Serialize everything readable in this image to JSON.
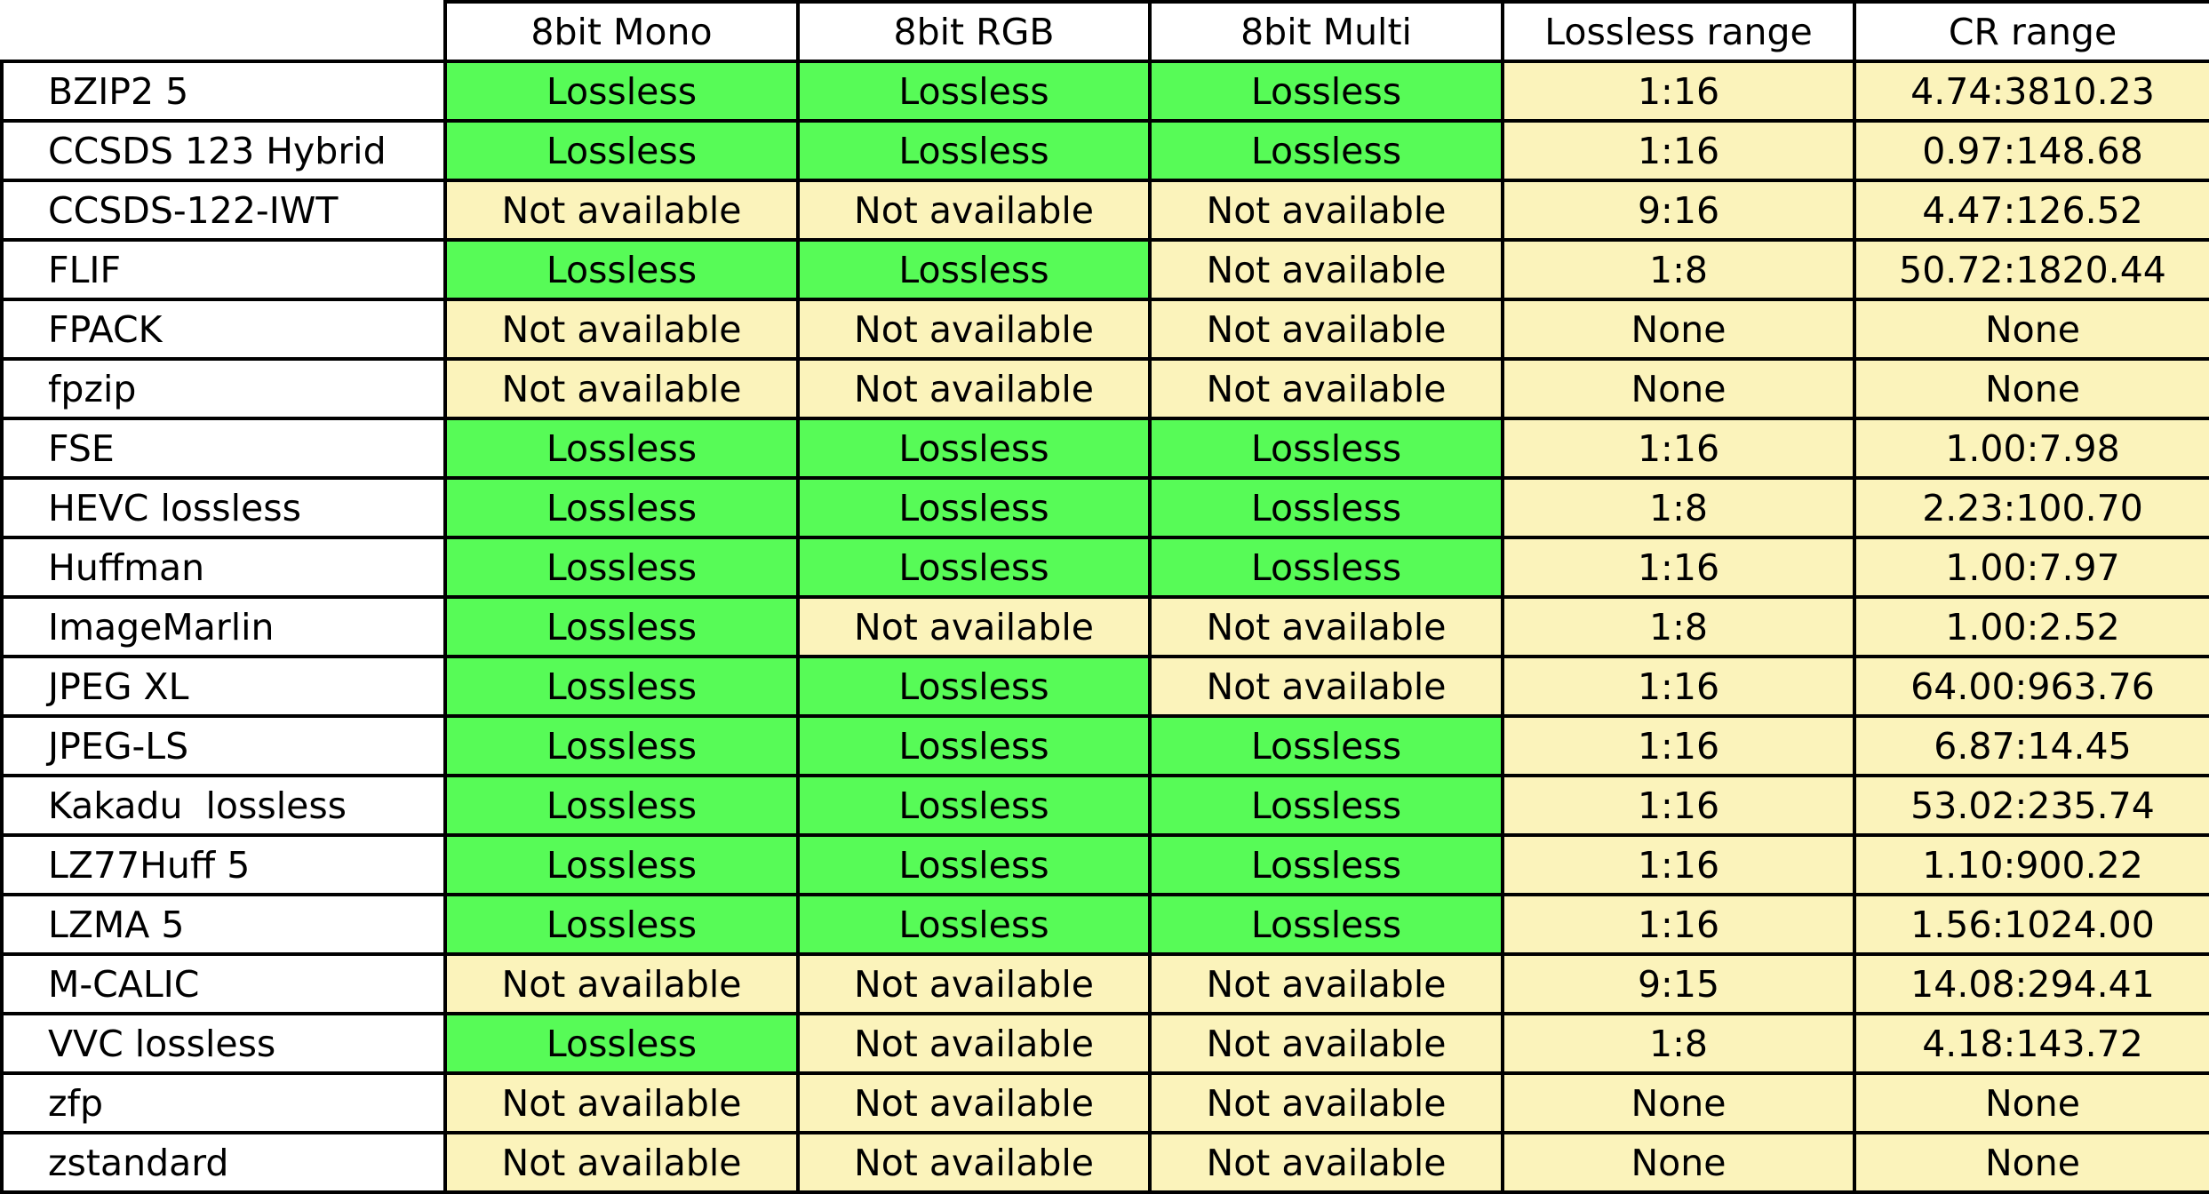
{
  "colors": {
    "lossless": "#57FB57",
    "not_available": "#FBF3BB"
  },
  "columns": [
    "8bit Mono",
    "8bit RGB",
    "8bit Multi",
    "Lossless range",
    "CR range"
  ],
  "rows": [
    {
      "name": "BZIP2 5",
      "mono": "Lossless",
      "rgb": "Lossless",
      "multi": "Lossless",
      "lossless_range": "1:16",
      "cr_range": "4.74:3810.23"
    },
    {
      "name": "CCSDS 123 Hybrid",
      "mono": "Lossless",
      "rgb": "Lossless",
      "multi": "Lossless",
      "lossless_range": "1:16",
      "cr_range": "0.97:148.68"
    },
    {
      "name": "CCSDS-122-IWT",
      "mono": "Not available",
      "rgb": "Not available",
      "multi": "Not available",
      "lossless_range": "9:16",
      "cr_range": "4.47:126.52"
    },
    {
      "name": "FLIF",
      "mono": "Lossless",
      "rgb": "Lossless",
      "multi": "Not available",
      "lossless_range": "1:8",
      "cr_range": "50.72:1820.44"
    },
    {
      "name": "FPACK",
      "mono": "Not available",
      "rgb": "Not available",
      "multi": "Not available",
      "lossless_range": "None",
      "cr_range": "None"
    },
    {
      "name": "fpzip",
      "mono": "Not available",
      "rgb": "Not available",
      "multi": "Not available",
      "lossless_range": "None",
      "cr_range": "None"
    },
    {
      "name": "FSE",
      "mono": "Lossless",
      "rgb": "Lossless",
      "multi": "Lossless",
      "lossless_range": "1:16",
      "cr_range": "1.00:7.98"
    },
    {
      "name": "HEVC lossless",
      "mono": "Lossless",
      "rgb": "Lossless",
      "multi": "Lossless",
      "lossless_range": "1:8",
      "cr_range": "2.23:100.70"
    },
    {
      "name": "Huffman",
      "mono": "Lossless",
      "rgb": "Lossless",
      "multi": "Lossless",
      "lossless_range": "1:16",
      "cr_range": "1.00:7.97"
    },
    {
      "name": "ImageMarlin",
      "mono": "Lossless",
      "rgb": "Not available",
      "multi": "Not available",
      "lossless_range": "1:8",
      "cr_range": "1.00:2.52"
    },
    {
      "name": "JPEG XL",
      "mono": "Lossless",
      "rgb": "Lossless",
      "multi": "Not available",
      "lossless_range": "1:16",
      "cr_range": "64.00:963.76"
    },
    {
      "name": "JPEG-LS",
      "mono": "Lossless",
      "rgb": "Lossless",
      "multi": "Lossless",
      "lossless_range": "1:16",
      "cr_range": "6.87:14.45"
    },
    {
      "name": "Kakadu  lossless",
      "mono": "Lossless",
      "rgb": "Lossless",
      "multi": "Lossless",
      "lossless_range": "1:16",
      "cr_range": "53.02:235.74"
    },
    {
      "name": "LZ77Huff 5",
      "mono": "Lossless",
      "rgb": "Lossless",
      "multi": "Lossless",
      "lossless_range": "1:16",
      "cr_range": "1.10:900.22"
    },
    {
      "name": "LZMA 5",
      "mono": "Lossless",
      "rgb": "Lossless",
      "multi": "Lossless",
      "lossless_range": "1:16",
      "cr_range": "1.56:1024.00"
    },
    {
      "name": "M-CALIC",
      "mono": "Not available",
      "rgb": "Not available",
      "multi": "Not available",
      "lossless_range": "9:15",
      "cr_range": "14.08:294.41"
    },
    {
      "name": "VVC lossless",
      "mono": "Lossless",
      "rgb": "Not available",
      "multi": "Not available",
      "lossless_range": "1:8",
      "cr_range": "4.18:143.72"
    },
    {
      "name": "zfp",
      "mono": "Not available",
      "rgb": "Not available",
      "multi": "Not available",
      "lossless_range": "None",
      "cr_range": "None"
    },
    {
      "name": "zstandard",
      "mono": "Not available",
      "rgb": "Not available",
      "multi": "Not available",
      "lossless_range": "None",
      "cr_range": "None"
    }
  ]
}
